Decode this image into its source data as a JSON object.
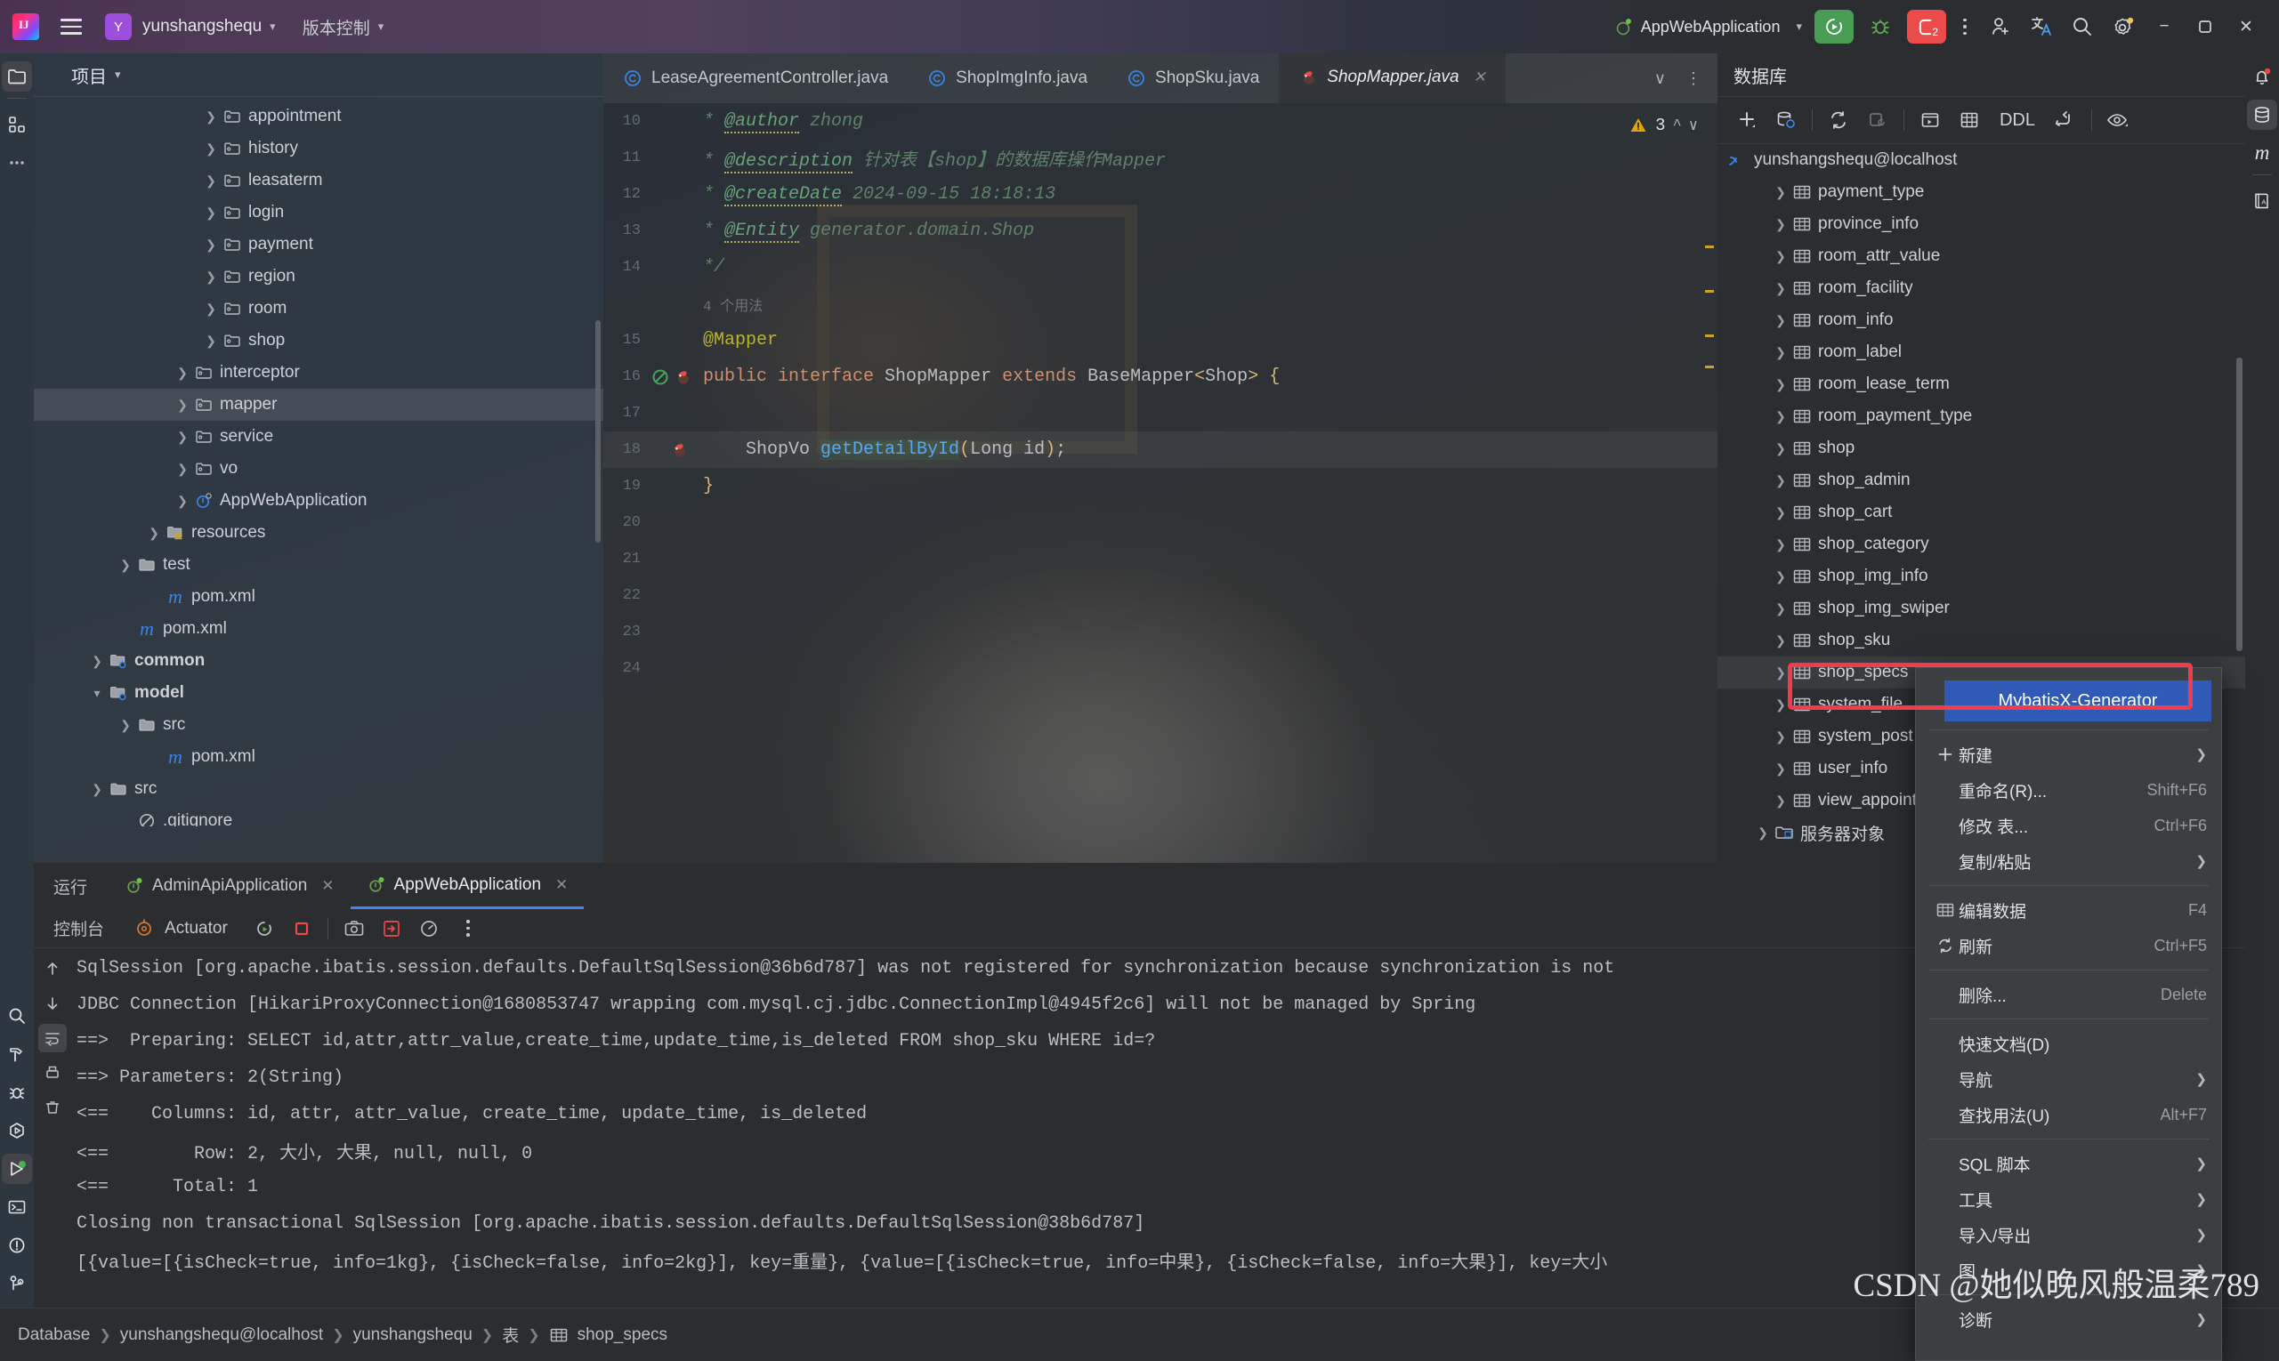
{
  "titlebar": {
    "project_badge": "Y",
    "project_name": "yunshangshequ",
    "vcs_label": "版本控制",
    "run_config": "AppWebApplication",
    "stop_count": "2",
    "icons": [
      "intellij-logo-icon",
      "hamburger-menu-icon",
      "chevron-down-icon",
      "run-icon",
      "debug-icon",
      "stop-icon",
      "more-options-icon",
      "add-user-icon",
      "translate-icon",
      "search-icon",
      "settings-icon",
      "minimize-icon",
      "maximize-icon",
      "close-icon"
    ]
  },
  "left_stripe": {
    "top": [
      "project-icon",
      "structure-icon",
      "more-tool-windows-icon"
    ],
    "bottom": [
      "search-icon",
      "build-icon",
      "debug-icon",
      "services-icon",
      "run-icon",
      "terminal-icon",
      "problems-icon",
      "git-icon"
    ]
  },
  "right_stripe": {
    "items": [
      "notifications-icon",
      "database-icon",
      "maven-icon",
      "translation-icon"
    ]
  },
  "project_panel": {
    "title": "项目",
    "tree": [
      {
        "label": "appointment",
        "indent": 5,
        "icon": "package-folder-icon",
        "arrow": "right",
        "selected": false
      },
      {
        "label": "history",
        "indent": 5,
        "icon": "package-folder-icon",
        "arrow": "right",
        "selected": false
      },
      {
        "label": "leasaterm",
        "indent": 5,
        "icon": "package-folder-icon",
        "arrow": "right",
        "selected": false
      },
      {
        "label": "login",
        "indent": 5,
        "icon": "package-folder-icon",
        "arrow": "right",
        "selected": false
      },
      {
        "label": "payment",
        "indent": 5,
        "icon": "package-folder-icon",
        "arrow": "right",
        "selected": false
      },
      {
        "label": "region",
        "indent": 5,
        "icon": "package-folder-icon",
        "arrow": "right",
        "selected": false
      },
      {
        "label": "room",
        "indent": 5,
        "icon": "package-folder-icon",
        "arrow": "right",
        "selected": false
      },
      {
        "label": "shop",
        "indent": 5,
        "icon": "package-folder-icon",
        "arrow": "right",
        "selected": false
      },
      {
        "label": "interceptor",
        "indent": 4,
        "icon": "package-folder-icon",
        "arrow": "right",
        "selected": false
      },
      {
        "label": "mapper",
        "indent": 4,
        "icon": "package-folder-icon",
        "arrow": "right",
        "selected": true
      },
      {
        "label": "service",
        "indent": 4,
        "icon": "package-folder-icon",
        "arrow": "right",
        "selected": false
      },
      {
        "label": "vo",
        "indent": 4,
        "icon": "package-folder-icon",
        "arrow": "right",
        "selected": false
      },
      {
        "label": "AppWebApplication",
        "indent": 4,
        "icon": "spring-class-icon",
        "arrow": "right",
        "selected": false
      },
      {
        "label": "resources",
        "indent": 3,
        "icon": "resources-folder-icon",
        "arrow": "right",
        "selected": false
      },
      {
        "label": "test",
        "indent": 2,
        "icon": "folder-icon",
        "arrow": "right",
        "selected": false
      },
      {
        "label": "pom.xml",
        "indent": 3,
        "icon": "maven-file-icon",
        "arrow": "none",
        "selected": false
      },
      {
        "label": "pom.xml",
        "indent": 2,
        "icon": "maven-file-icon",
        "arrow": "none",
        "selected": false
      },
      {
        "label": "common",
        "indent": 1,
        "icon": "module-folder-icon",
        "arrow": "right",
        "selected": false,
        "bold": true
      },
      {
        "label": "model",
        "indent": 1,
        "icon": "module-folder-icon",
        "arrow": "down",
        "selected": false,
        "bold": true
      },
      {
        "label": "src",
        "indent": 2,
        "icon": "folder-icon",
        "arrow": "right",
        "selected": false
      },
      {
        "label": "pom.xml",
        "indent": 3,
        "icon": "maven-file-icon",
        "arrow": "none",
        "selected": false
      },
      {
        "label": "src",
        "indent": 1,
        "icon": "folder-icon",
        "arrow": "right",
        "selected": false
      },
      {
        "label": ".gitignore",
        "indent": 2,
        "icon": "gitignore-icon",
        "arrow": "none",
        "selected": false
      }
    ]
  },
  "editor": {
    "tabs": [
      {
        "label": "LeaseAgreementController.java",
        "icon": "java-class-icon",
        "active": false,
        "closable": false
      },
      {
        "label": "ShopImgInfo.java",
        "icon": "java-class-icon",
        "active": false,
        "closable": false
      },
      {
        "label": "ShopSku.java",
        "icon": "java-class-icon",
        "active": false,
        "closable": false
      },
      {
        "label": "ShopMapper.java",
        "icon": "mybatis-mapper-icon",
        "active": true,
        "closable": true
      }
    ],
    "warning_count": "3",
    "usages_hint": "4 个用法",
    "lines": [
      {
        "num": "10",
        "type": "comment",
        "star": "*",
        "tag": "@author",
        "rest": " zhong"
      },
      {
        "num": "11",
        "type": "comment",
        "star": "*",
        "tag": "@description",
        "rest": " 针对表【shop】的数据库操作Mapper"
      },
      {
        "num": "12",
        "type": "comment",
        "star": "*",
        "tag": "@createDate",
        "rest": " 2024-09-15 18:18:13"
      },
      {
        "num": "13",
        "type": "comment",
        "star": "*",
        "tag": "@Entity",
        "rest": " generator.domain.Shop"
      },
      {
        "num": "14",
        "type": "commentend",
        "star": "*/",
        "tag": "",
        "rest": ""
      },
      {
        "num": "15",
        "type": "annotation",
        "text": "@Mapper"
      },
      {
        "num": "16",
        "type": "interface",
        "text": "public interface ShopMapper extends BaseMapper<Shop> {"
      },
      {
        "num": "17",
        "type": "blank",
        "text": ""
      },
      {
        "num": "18",
        "type": "method",
        "text": "ShopVo getDetailById(Long id);"
      },
      {
        "num": "19",
        "type": "closebrace",
        "text": "}"
      },
      {
        "num": "20",
        "type": "blank",
        "text": ""
      },
      {
        "num": "21",
        "type": "blank",
        "text": ""
      },
      {
        "num": "22",
        "type": "blank",
        "text": ""
      },
      {
        "num": "23",
        "type": "blank",
        "text": ""
      },
      {
        "num": "24",
        "type": "blank",
        "text": ""
      }
    ]
  },
  "database_panel": {
    "title": "数据库",
    "toolbar": {
      "ddl_label": "DDL",
      "icons": [
        "add-icon",
        "data-source-properties-icon",
        "refresh-icon",
        "close-connection-icon",
        "open-console-icon",
        "data-editor-icon",
        "ddl-button",
        "jump-to-query-icon",
        "view-options-icon"
      ]
    },
    "connection": "yunshangshequ@localhost",
    "tables": [
      {
        "label": "payment_type",
        "selected": false
      },
      {
        "label": "province_info",
        "selected": false
      },
      {
        "label": "room_attr_value",
        "selected": false
      },
      {
        "label": "room_facility",
        "selected": false
      },
      {
        "label": "room_info",
        "selected": false
      },
      {
        "label": "room_label",
        "selected": false
      },
      {
        "label": "room_lease_term",
        "selected": false
      },
      {
        "label": "room_payment_type",
        "selected": false
      },
      {
        "label": "shop",
        "selected": false
      },
      {
        "label": "shop_admin",
        "selected": false
      },
      {
        "label": "shop_cart",
        "selected": false
      },
      {
        "label": "shop_category",
        "selected": false
      },
      {
        "label": "shop_img_info",
        "selected": false
      },
      {
        "label": "shop_img_swiper",
        "selected": false
      },
      {
        "label": "shop_sku",
        "selected": false
      },
      {
        "label": "shop_specs",
        "selected": true
      },
      {
        "label": "system_file",
        "selected": false
      },
      {
        "label": "system_post",
        "selected": false
      },
      {
        "label": "user_info",
        "selected": false
      },
      {
        "label": "view_appointment",
        "selected": false
      }
    ],
    "server_objects": "服务器对象"
  },
  "context_menu": {
    "highlighted_item": "MybatisX-Generator",
    "items": [
      {
        "label": "新建",
        "key": "",
        "submenu": true,
        "icon": "plus-icon"
      },
      {
        "label": "重命名(R)...",
        "key": "Shift+F6",
        "submenu": false,
        "icon": ""
      },
      {
        "label": "修改 表...",
        "key": "Ctrl+F6",
        "submenu": false,
        "icon": ""
      },
      {
        "label": "复制/粘贴",
        "key": "",
        "submenu": true,
        "icon": ""
      },
      {
        "separator": true
      },
      {
        "label": "编辑数据",
        "key": "F4",
        "submenu": false,
        "icon": "table-icon"
      },
      {
        "label": "刷新",
        "key": "Ctrl+F5",
        "submenu": false,
        "icon": "refresh-icon"
      },
      {
        "separator": true
      },
      {
        "label": "删除...",
        "key": "Delete",
        "submenu": false,
        "icon": ""
      },
      {
        "separator": true
      },
      {
        "label": "快速文档(D)",
        "key": "",
        "submenu": false,
        "icon": ""
      },
      {
        "label": "导航",
        "key": "",
        "submenu": true,
        "icon": ""
      },
      {
        "label": "查找用法(U)",
        "key": "Alt+F7",
        "submenu": false,
        "icon": ""
      },
      {
        "separator": true
      },
      {
        "label": "SQL 脚本",
        "key": "",
        "submenu": true,
        "icon": ""
      },
      {
        "label": "工具",
        "key": "",
        "submenu": true,
        "icon": ""
      },
      {
        "label": "导入/导出",
        "key": "",
        "submenu": true,
        "icon": ""
      },
      {
        "label": "图",
        "key": "",
        "submenu": true,
        "icon": ""
      },
      {
        "separator": true
      },
      {
        "label": "诊断",
        "key": "",
        "submenu": true,
        "icon": ""
      }
    ]
  },
  "run_panel": {
    "run_label": "运行",
    "tabs": [
      {
        "label": "AdminApiApplication",
        "active": false
      },
      {
        "label": "AppWebApplication",
        "active": true
      }
    ],
    "console_label": "控制台",
    "actuator_label": "Actuator",
    "toolbar_icons": [
      "rerun-icon",
      "stop-icon",
      "screenshot-icon",
      "export-icon",
      "profiler-icon",
      "more-options-icon"
    ],
    "gutter_icons": [
      "scroll-up-icon",
      "scroll-down-icon",
      "soft-wrap-icon",
      "print-icon",
      "clear-all-icon"
    ],
    "log": [
      "SqlSession [org.apache.ibatis.session.defaults.DefaultSqlSession@36b6d787] was not registered for synchronization because synchronization is not",
      "JDBC Connection [HikariProxyConnection@1680853747 wrapping com.mysql.cj.jdbc.ConnectionImpl@4945f2c6] will not be managed by Spring",
      "==>  Preparing: SELECT id,attr,attr_value,create_time,update_time,is_deleted FROM shop_sku WHERE id=?",
      "==> Parameters: 2(String)",
      "<==    Columns: id, attr, attr_value, create_time, update_time, is_deleted",
      "<==        Row: 2, 大小, 大果, null, null, 0",
      "<==      Total: 1",
      "Closing non transactional SqlSession [org.apache.ibatis.session.defaults.DefaultSqlSession@38b6d787]",
      "[{value=[{isCheck=true, info=1kg}, {isCheck=false, info=2kg}], key=重量}, {value=[{isCheck=true, info=中果}, {isCheck=false, info=大果}], key=大小"
    ]
  },
  "status_bar": {
    "breadcrumb": [
      "Database",
      "yunshangshequ@localhost",
      "yunshangshequ",
      "表",
      "shop_specs"
    ],
    "table_icon": "table-icon"
  },
  "watermark": "CSDN @她似晚风般温柔789",
  "colors": {
    "accent_blue": "#2f5bb7",
    "run_green": "#499c54",
    "stop_red": "#eb4b4b",
    "annotation_red": "#f43b4c",
    "badge_purple": "#9d4edd"
  }
}
